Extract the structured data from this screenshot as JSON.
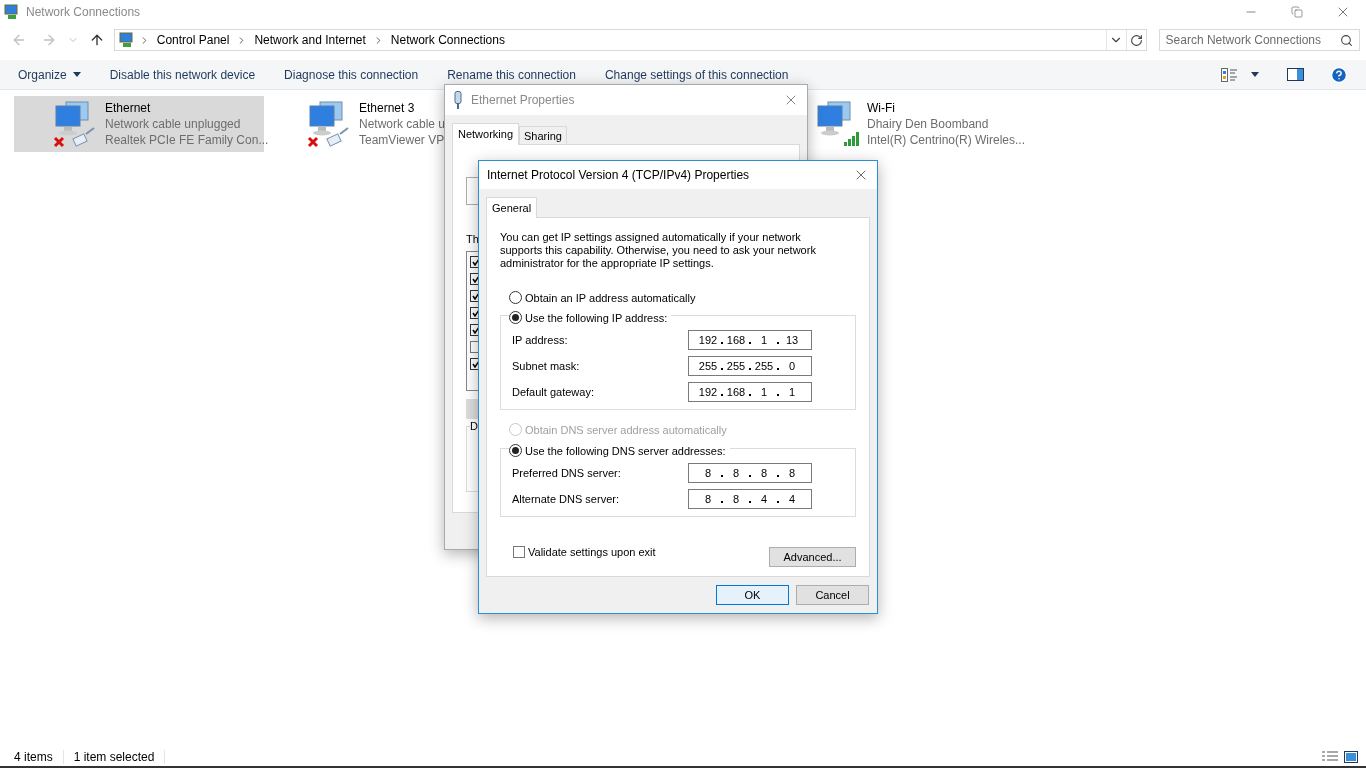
{
  "window": {
    "title": "Network Connections"
  },
  "address_bar": {
    "crumbs": [
      "Control Panel",
      "Network and Internet",
      "Network Connections"
    ]
  },
  "search": {
    "placeholder": "Search Network Connections"
  },
  "toolbar": {
    "items": [
      {
        "label": "Organize",
        "kind": "menu"
      },
      {
        "label": "Disable this network device",
        "kind": "command"
      },
      {
        "label": "Diagnose this connection",
        "kind": "command"
      },
      {
        "label": "Rename this connection",
        "kind": "command"
      },
      {
        "label": "Change settings of this connection",
        "kind": "command"
      }
    ]
  },
  "connections": [
    {
      "name": "Ethernet",
      "status": "Network cable unplugged",
      "device": "Realtek PCIe FE Family Con...",
      "selected": true,
      "kind": "wired"
    },
    {
      "name": "Ethernet 3",
      "status": "Network cable u",
      "device": "TeamViewer VP",
      "selected": false,
      "kind": "wired"
    },
    {
      "name": "Wi-Fi",
      "status": "Dhairy Den Boomband",
      "device": "Intel(R) Centrino(R) Wireles...",
      "selected": false,
      "kind": "wireless"
    }
  ],
  "status_bar": {
    "items": [
      "4 items",
      "1 item selected"
    ]
  },
  "ethernet_properties": {
    "title": "Ethernet Properties",
    "tabs": [
      {
        "label": "Networking",
        "selected": true
      },
      {
        "label": "Sharing",
        "selected": false
      }
    ],
    "list_label": "Th",
    "components": [
      {
        "checked": true
      },
      {
        "checked": true
      },
      {
        "checked": true
      },
      {
        "checked": true
      },
      {
        "checked": true
      },
      {
        "checked": false
      },
      {
        "checked": true
      }
    ],
    "group_label": "D"
  },
  "ipv4_properties": {
    "title": "Internet Protocol Version 4 (TCP/IPv4) Properties",
    "tabs": [
      {
        "label": "General",
        "selected": true
      }
    ],
    "intro": "You can get IP settings assigned automatically if your network supports this capability. Otherwise, you need to ask your network administrator for the appropriate IP settings.",
    "ip_modes": [
      {
        "label": "Obtain an IP address automatically",
        "selected": false,
        "disabled": false
      },
      {
        "label": "Use the following IP address:",
        "selected": true,
        "disabled": false
      }
    ],
    "ip_fields": [
      {
        "label": "IP address:",
        "octets": [
          "192",
          "168",
          "1",
          "13"
        ]
      },
      {
        "label": "Subnet mask:",
        "octets": [
          "255",
          "255",
          "255",
          "0"
        ]
      },
      {
        "label": "Default gateway:",
        "octets": [
          "192",
          "168",
          "1",
          "1"
        ]
      }
    ],
    "dns_modes": [
      {
        "label": "Obtain DNS server address automatically",
        "selected": false,
        "disabled": true
      },
      {
        "label": "Use the following DNS server addresses:",
        "selected": true,
        "disabled": false
      }
    ],
    "dns_fields": [
      {
        "label": "Preferred DNS server:",
        "octets": [
          "8",
          "8",
          "8",
          "8"
        ]
      },
      {
        "label": "Alternate DNS server:",
        "octets": [
          "8",
          "8",
          "4",
          "4"
        ]
      }
    ],
    "validate": {
      "label": "Validate settings upon exit",
      "checked": false
    },
    "advanced_button": "Advanced...",
    "buttons": [
      {
        "label": "OK",
        "default": true
      },
      {
        "label": "Cancel",
        "default": false
      }
    ]
  }
}
